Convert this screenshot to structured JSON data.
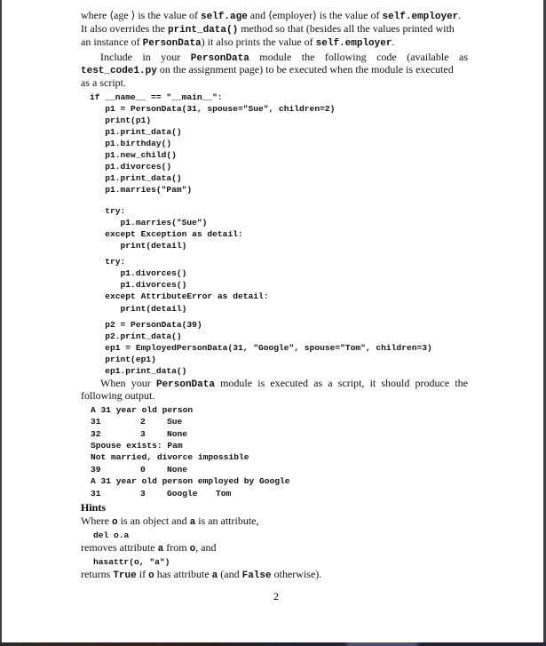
{
  "para1": {
    "l1": [
      "where ⟨age ⟩ is the value of ",
      "self.age",
      " and ⟨employer⟩ is the value of ",
      "self.employer",
      "."
    ],
    "l2": [
      "It also overrides the ",
      "print_data()",
      " method so that (besides all the values printed with"
    ],
    "l3": [
      "an instance of ",
      "PersonData",
      ") it also prints the value of ",
      "self.employer",
      "."
    ]
  },
  "para2": {
    "l1": [
      "Include in your ",
      "PersonData",
      " module the following code (available as"
    ],
    "l2": [
      "test_code1.py",
      " on the assignment page) to be executed when the module is executed"
    ],
    "l3": "as a script."
  },
  "code_block": [
    "if __name__ == \"__main__\":",
    "   p1 = PersonData(31, spouse=\"Sue\", children=2)",
    "   print(p1)",
    "   p1.print_data()",
    "   p1.birthday()",
    "   p1.new_child()",
    "   p1.divorces()",
    "   p1.print_data()",
    "   p1.marries(\"Pam\")",
    "   try:",
    "      p1.marries(\"Sue\")",
    "   except Exception as detail:",
    "      print(detail)",
    "   try:",
    "      p1.divorces()",
    "      p1.divorces()",
    "   except AttributeError as detail:",
    "      print(detail)",
    "   p2 = PersonData(39)",
    "   p2.print_data()",
    "   ep1 = EmployedPersonData(31, \"Google\", spouse=\"Tom\", children=3)",
    "   print(ep1)",
    "   ep1.print_data()"
  ],
  "para3": {
    "l1": [
      "When your ",
      "PersonData",
      " module is executed as a script, it should produce the"
    ],
    "l2": "following output."
  },
  "output_block": [
    [
      "A 31 year old person"
    ],
    [
      "31",
      "2",
      "Sue"
    ],
    [
      "32",
      "3",
      "None"
    ],
    [
      "Spouse exists: Pam"
    ],
    [
      "Not married, divorce impossible"
    ],
    [
      "39",
      "0",
      "None"
    ],
    [
      "A 31 year old person employed by Google"
    ],
    [
      "31",
      "3",
      "Google",
      "Tom"
    ]
  ],
  "hints": {
    "title": "Hints",
    "l1": [
      "Where ",
      "o",
      " is an object and ",
      "a",
      " is an attribute,"
    ],
    "code1": "del o.a",
    "l2": [
      "removes attribute ",
      "a",
      " from ",
      "o",
      ", and"
    ],
    "code2": "hasattr(o, \"a\")",
    "l3": [
      "returns ",
      "True",
      " if ",
      "o",
      " has attribute ",
      "a",
      " (and ",
      "False",
      " otherwise)."
    ]
  },
  "page_number": "2"
}
